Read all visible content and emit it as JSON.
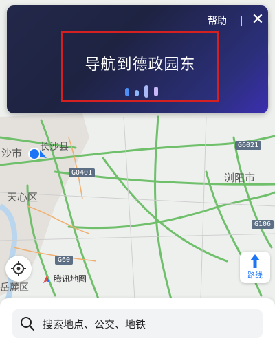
{
  "voice_panel": {
    "help_label": "帮助",
    "close_label": "✕",
    "command_text": "导航到德政园东"
  },
  "map": {
    "labels": {
      "changsha_city": "沙市",
      "changsha_county": "长沙县",
      "tianxin": "天心区",
      "liuyang": "浏阳市",
      "yuelu": "岳麓区"
    },
    "roads": {
      "g6021": "G6021",
      "g0401": "G0401",
      "g106": "G106",
      "g60": "G60"
    },
    "watermark": "腾讯地图"
  },
  "controls": {
    "route_label": "路线"
  },
  "search": {
    "placeholder": "搜索地点、公交、地铁"
  },
  "colors": {
    "accent": "#1d74f5",
    "panel_top": "#23284a",
    "panel_end": "#3b2fb0",
    "highlight_box": "#d42020",
    "road_green": "#6fbf6b",
    "road_badge": "#5d6f84"
  }
}
